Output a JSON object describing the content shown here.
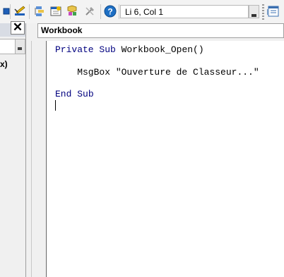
{
  "toolbar": {
    "status_text": "Li 6, Col 1",
    "icons": [
      "stop-square-icon",
      "design-mode-icon",
      "project-explorer-icon",
      "properties-window-icon",
      "object-browser-icon",
      "toolbox-icon",
      "help-icon",
      "toolbar-options-icon"
    ]
  },
  "left_panel": {
    "close_glyph": "✕",
    "item_label": "x)"
  },
  "editor": {
    "object_selector": "Workbook",
    "code_lines": {
      "l1_kw1": "Private",
      "l1_kw2": "Sub",
      "l1_rest": " Workbook_Open()",
      "l2_text": "    MsgBox \"Ouverture de Classeur...\"",
      "l3_kw1": "End",
      "l3_kw2": "Sub"
    }
  },
  "colors": {
    "keyword": "#00007f",
    "accent_blue": "#1e6fc4"
  }
}
